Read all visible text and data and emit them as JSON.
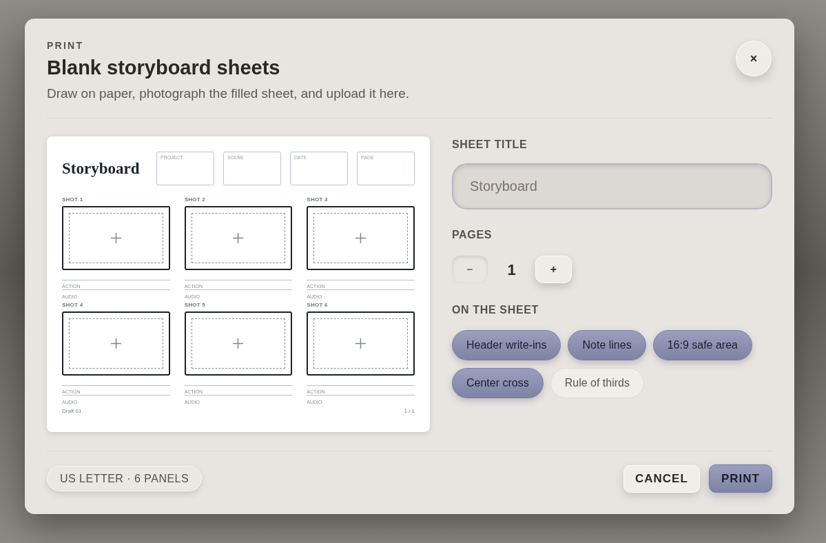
{
  "dialog": {
    "eyebrow": "PRINT",
    "title": "Blank storyboard sheets",
    "subtitle": "Draw on paper, photograph the filled sheet, and upload it here.",
    "close": "×"
  },
  "preview": {
    "title": "Storyboard",
    "header_fields": [
      "PROJECT",
      "SCENE",
      "DATE",
      "PAGE"
    ],
    "shots": [
      {
        "label": "SHOT 1",
        "notes": [
          "ACTION",
          "AUDIO"
        ]
      },
      {
        "label": "SHOT 2",
        "notes": [
          "ACTION",
          "AUDIO"
        ]
      },
      {
        "label": "SHOT 3",
        "notes": [
          "ACTION",
          "AUDIO"
        ]
      },
      {
        "label": "SHOT 4",
        "notes": [
          "ACTION",
          "AUDIO"
        ]
      },
      {
        "label": "SHOT 5",
        "notes": [
          "ACTION",
          "AUDIO"
        ]
      },
      {
        "label": "SHOT 6",
        "notes": [
          "ACTION",
          "AUDIO"
        ]
      }
    ],
    "footer_left": "Draft 01",
    "footer_right": "1 / 1"
  },
  "form": {
    "sheet_title": {
      "label": "SHEET TITLE",
      "placeholder": "Storyboard"
    },
    "pages": {
      "label": "PAGES",
      "value": "1",
      "decrement": {
        "label": "–",
        "disabled": true
      },
      "increment": {
        "label": "+",
        "disabled": false
      }
    },
    "options": {
      "label": "ON THE SHEET",
      "chips": [
        {
          "label": "Header write-ins",
          "selected": true
        },
        {
          "label": "Note lines",
          "selected": true
        },
        {
          "label": "16:9 safe area",
          "selected": true
        },
        {
          "label": "Center cross",
          "selected": true
        },
        {
          "label": "Rule of thirds",
          "selected": false
        }
      ]
    }
  },
  "footer": {
    "badge": "US LETTER · 6 PANELS",
    "buttons": [
      {
        "label": "CANCEL",
        "kind": "secondary"
      },
      {
        "label": "PRINT",
        "kind": "primary"
      }
    ]
  }
}
